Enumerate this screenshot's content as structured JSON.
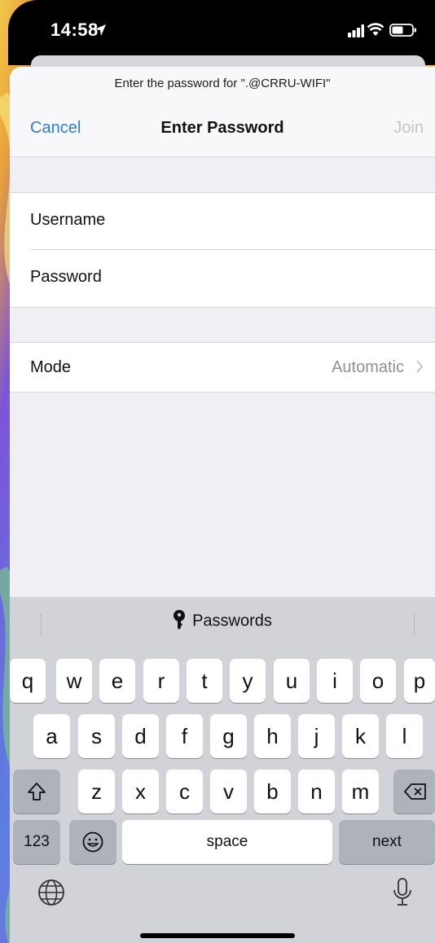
{
  "status_bar": {
    "time": "14:58"
  },
  "dialog": {
    "prompt": "Enter the password for \".@CRRU-WIFI\"",
    "cancel_label": "Cancel",
    "title": "Enter Password",
    "join_label": "Join"
  },
  "credentials": {
    "username_label": "Username",
    "password_label": "Password"
  },
  "mode": {
    "label": "Mode",
    "value": "Automatic"
  },
  "keyboard": {
    "quicktype_label": "Passwords",
    "row1": [
      "q",
      "w",
      "e",
      "r",
      "t",
      "y",
      "u",
      "i",
      "o",
      "p"
    ],
    "row2": [
      "a",
      "s",
      "d",
      "f",
      "g",
      "h",
      "j",
      "k",
      "l"
    ],
    "row3": [
      "z",
      "x",
      "c",
      "v",
      "b",
      "n",
      "m"
    ],
    "numbers_label": "123",
    "space_label": "space",
    "next_label": "next"
  },
  "colors": {
    "accent": "#2f7bd8",
    "disabled": "#c4c4c8",
    "secondary_text": "#8e8e93"
  },
  "icons": [
    "location-arrow-icon",
    "signal-icon",
    "wifi-icon",
    "battery-icon",
    "chevron-right-icon",
    "key-icon",
    "shift-icon",
    "delete-icon",
    "emoji-icon",
    "globe-icon",
    "microphone-icon"
  ]
}
